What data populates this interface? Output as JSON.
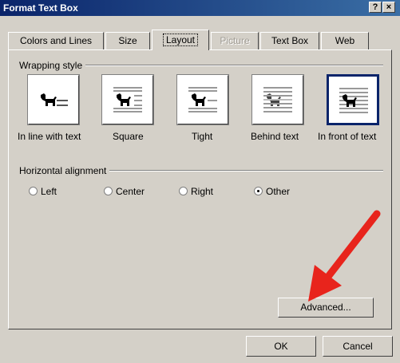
{
  "window": {
    "title": "Format Text Box",
    "help_glyph": "?",
    "close_glyph": "×"
  },
  "tabs": [
    {
      "label": "Colors and Lines"
    },
    {
      "label": "Size"
    },
    {
      "label": "Layout"
    },
    {
      "label": "Picture"
    },
    {
      "label": "Text Box"
    },
    {
      "label": "Web"
    }
  ],
  "wrapping": {
    "heading": "Wrapping style",
    "options": [
      {
        "label": "In line with text",
        "icon": "dog-inline-icon"
      },
      {
        "label": "Square",
        "icon": "dog-square-icon"
      },
      {
        "label": "Tight",
        "icon": "dog-tight-icon"
      },
      {
        "label": "Behind text",
        "icon": "dog-behind-icon"
      },
      {
        "label": "In front of text",
        "icon": "dog-front-icon"
      }
    ],
    "selected": "In front of text"
  },
  "alignment": {
    "heading": "Horizontal alignment",
    "options": [
      {
        "label": "Left"
      },
      {
        "label": "Center"
      },
      {
        "label": "Right"
      },
      {
        "label": "Other"
      }
    ],
    "selected": "Other"
  },
  "buttons": {
    "advanced": "Advanced...",
    "ok": "OK",
    "cancel": "Cancel"
  },
  "colors": {
    "title_bar": "#0a246a",
    "face": "#d4d0c8",
    "arrow": "#e8241c",
    "selection": "#0a246a"
  }
}
